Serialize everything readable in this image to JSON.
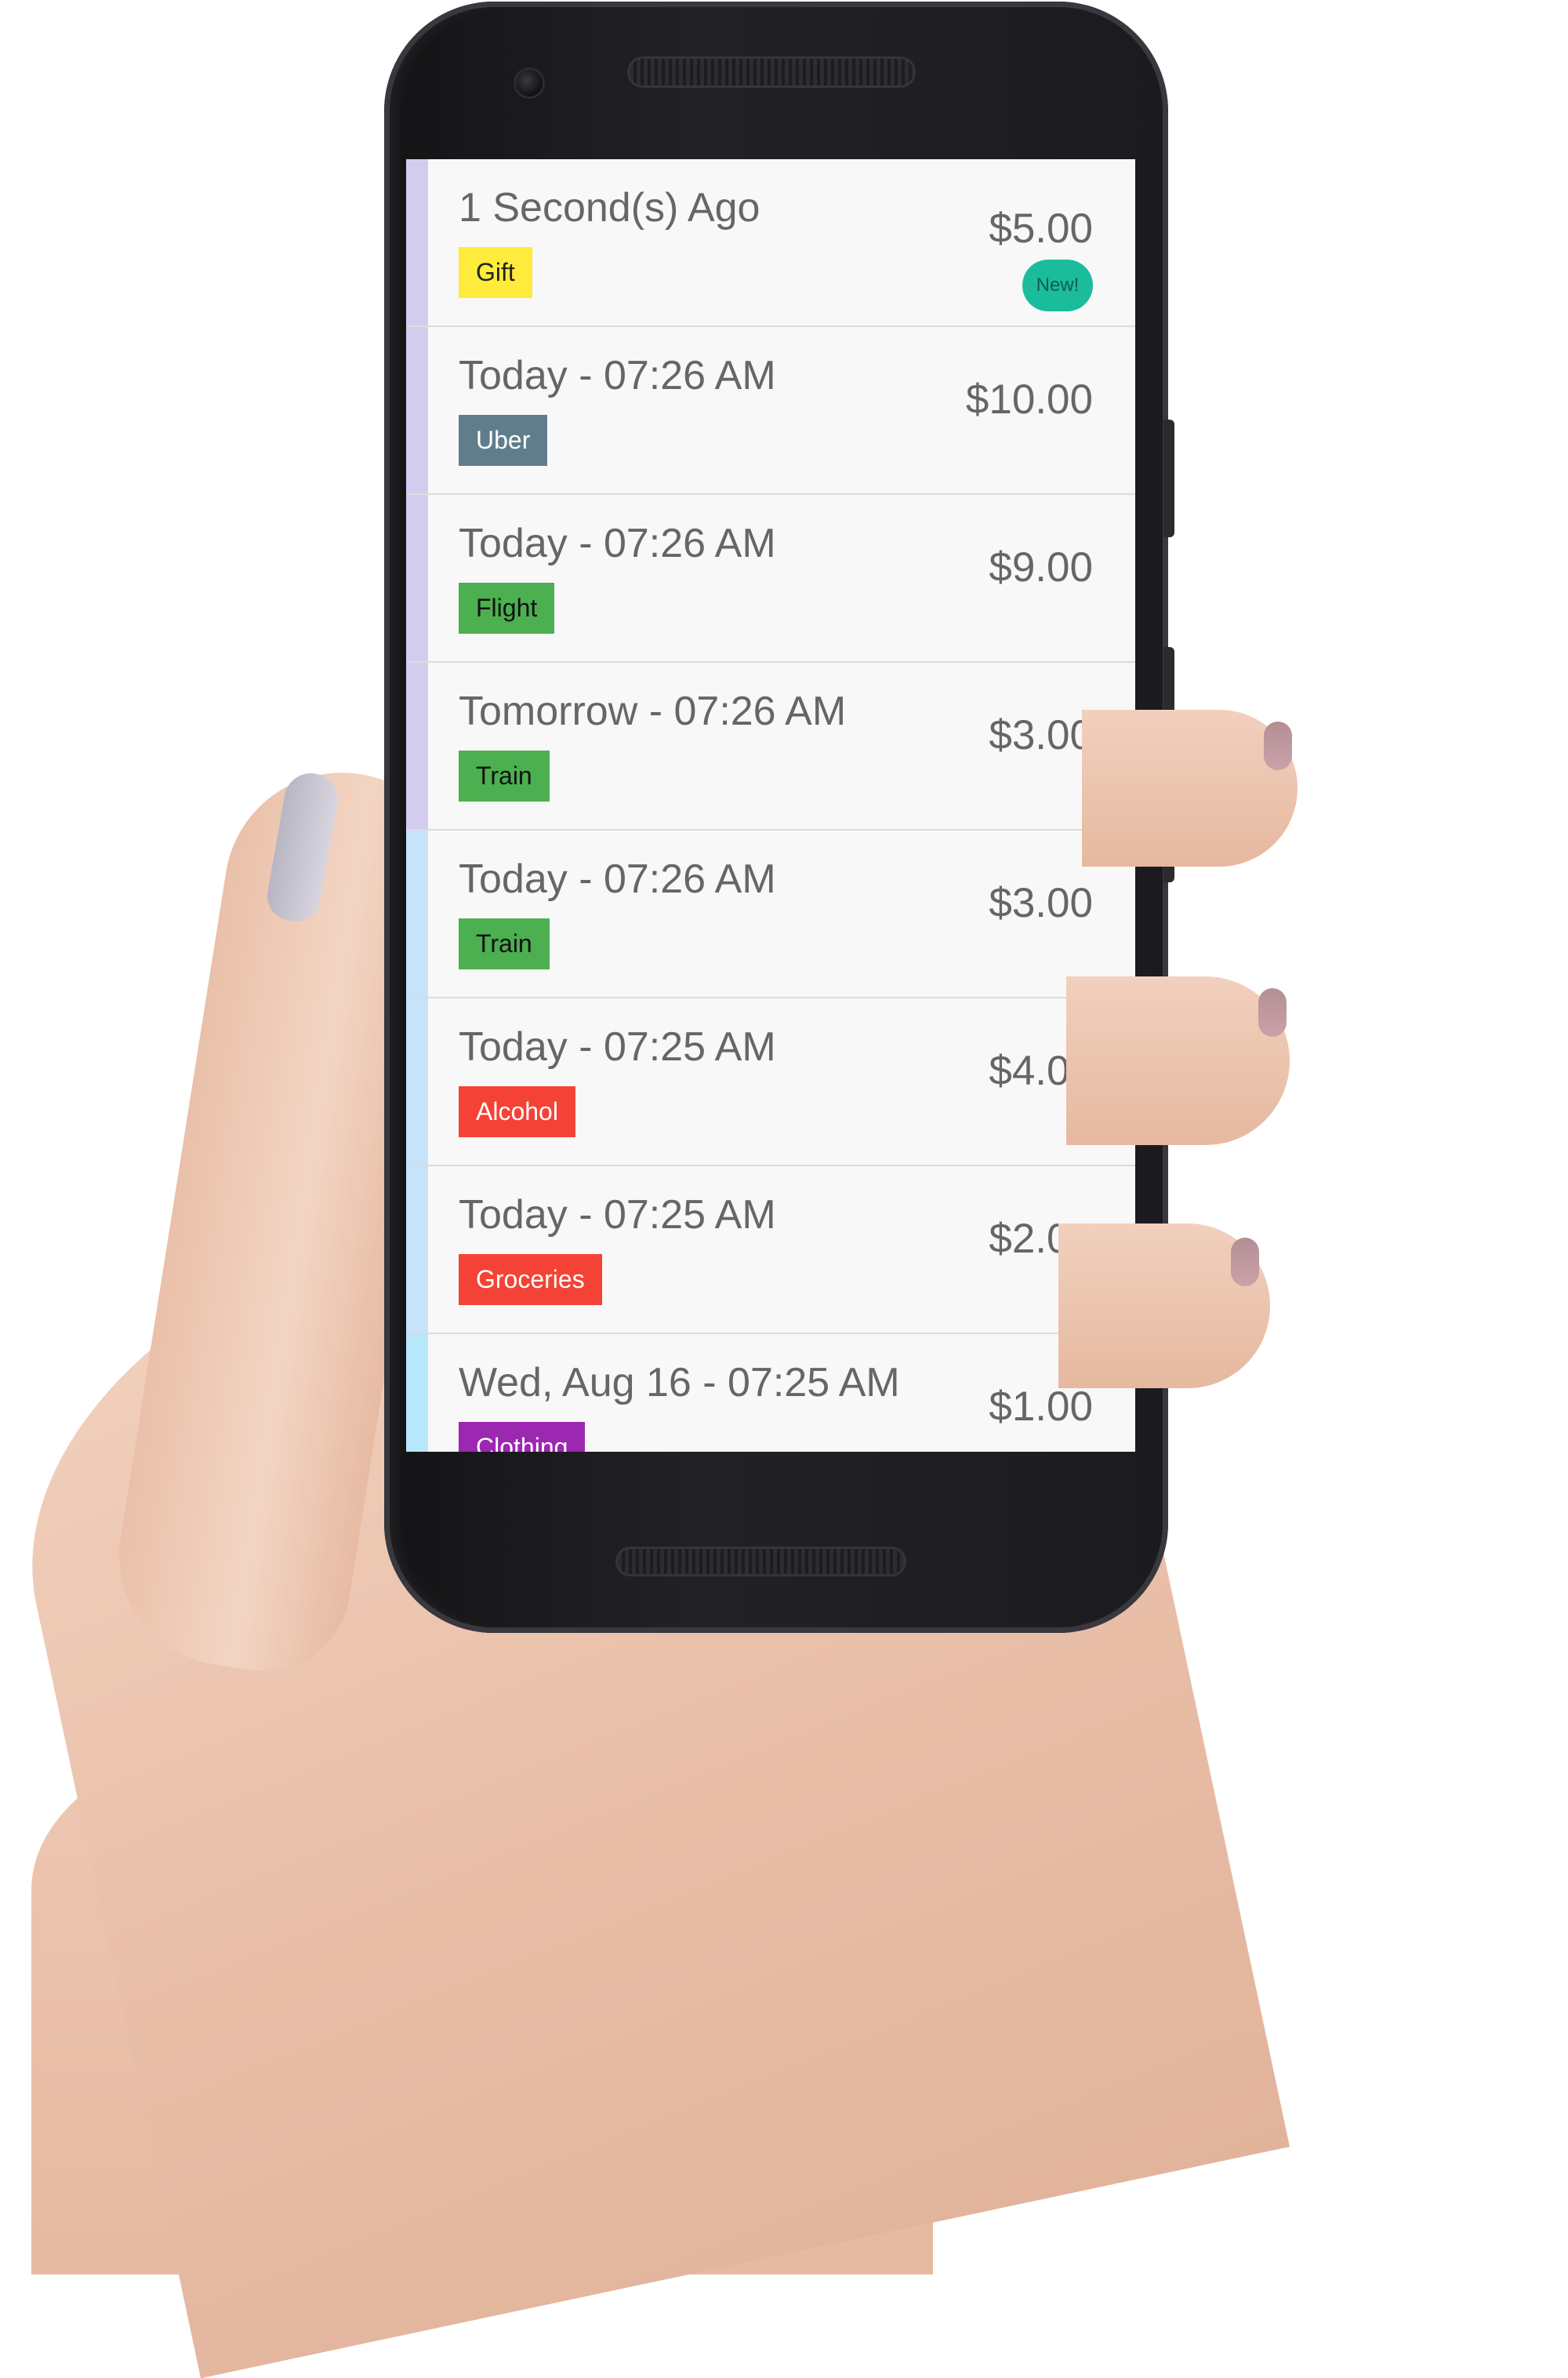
{
  "transactions": [
    {
      "when": "1 Second(s) Ago",
      "category": "Gift",
      "amount": "$5.00",
      "badge": "New!",
      "accent_color": "#d4ccee",
      "tag_bg": "#ffeb3b",
      "tag_fg": "#222222"
    },
    {
      "when": "Today - 07:26 AM",
      "category": "Uber",
      "amount": "$10.00",
      "accent_color": "#d4ccee",
      "tag_bg": "#607d8b",
      "tag_fg": "#ffffff"
    },
    {
      "when": "Today - 07:26 AM",
      "category": "Flight",
      "amount": "$9.00",
      "accent_color": "#d4ccee",
      "tag_bg": "#4caf50",
      "tag_fg": "#111111"
    },
    {
      "when": "Tomorrow - 07:26 AM",
      "category": "Train",
      "amount": "$3.00",
      "accent_color": "#d4ccee",
      "tag_bg": "#4caf50",
      "tag_fg": "#111111"
    },
    {
      "when": "Today - 07:26 AM",
      "category": "Train",
      "amount": "$3.00",
      "accent_color": "#c5e3fa",
      "tag_bg": "#4caf50",
      "tag_fg": "#111111"
    },
    {
      "when": "Today - 07:25 AM",
      "category": "Alcohol",
      "amount": "$4.00",
      "accent_color": "#c5e3fa",
      "tag_bg": "#f44336",
      "tag_fg": "#ffffff"
    },
    {
      "when": "Today - 07:25 AM",
      "category": "Groceries",
      "amount": "$2.00",
      "accent_color": "#c5e3fa",
      "tag_bg": "#f44336",
      "tag_fg": "#ffffff"
    },
    {
      "when": "Wed, Aug 16 - 07:25 AM",
      "category": "Clothing",
      "amount": "$1.00",
      "accent_color": "#b8e6fb",
      "tag_bg": "#9c27b0",
      "tag_fg": "#ffffff"
    }
  ]
}
